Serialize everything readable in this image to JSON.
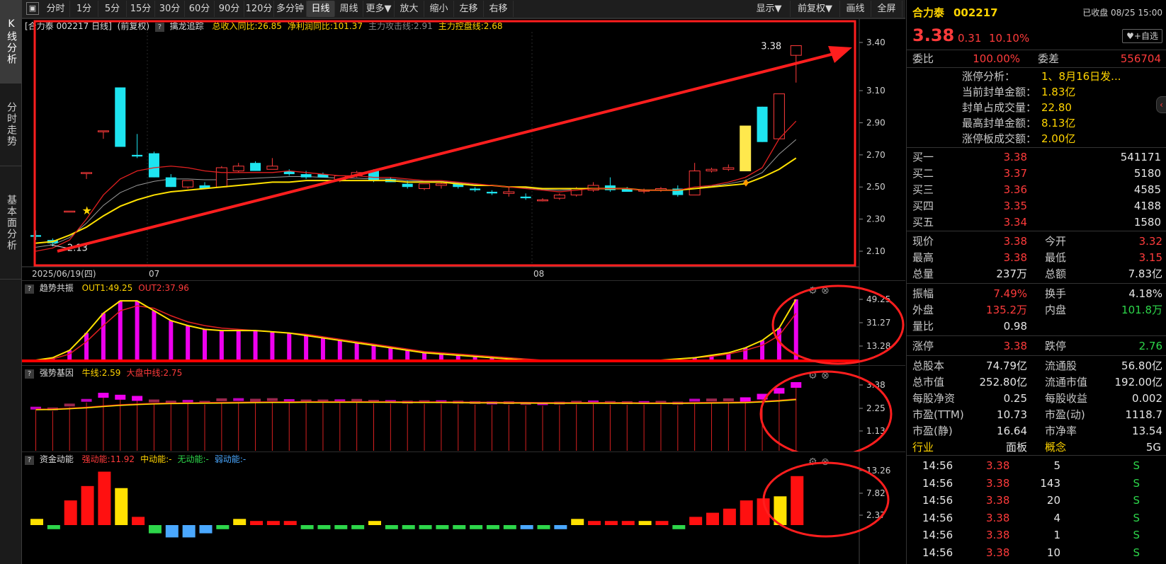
{
  "vtabs": [
    "K线分析",
    "分时走势",
    "基本面分析"
  ],
  "toolbar": {
    "periods": [
      "分时",
      "1分",
      "5分",
      "15分",
      "30分",
      "60分",
      "90分",
      "120分",
      "多分钟",
      "日线",
      "周线",
      "更多▼",
      "放大",
      "缩小",
      "左移",
      "右移"
    ],
    "active_period": "日线",
    "right": [
      "显示▼",
      "前复权▼",
      "画线",
      "全屏"
    ]
  },
  "main_chart": {
    "title_stock": "[合力泰 002217 日线]",
    "title_adjust": "(前复权)",
    "indicator_name": "擒龙追踪",
    "ind_items": [
      {
        "text": "总收入同比:26.85",
        "color": "#ffd400"
      },
      {
        "text": "净利润同比:101.37",
        "color": "#ffd400"
      },
      {
        "text": "主力攻击线:2.91",
        "color": "#888888"
      },
      {
        "text": "主力控盘线:2.68",
        "color": "#ffd400"
      }
    ],
    "y_ticks": [
      "3.40",
      "3.10",
      "2.90",
      "2.70",
      "2.50",
      "2.30",
      "2.10"
    ],
    "x_labels": [
      "2025/06/19(四)",
      "07",
      "08"
    ],
    "high_label": "3.38",
    "low_label": "2.13",
    "colors": {
      "up": "#ff3b3b",
      "down": "#1ee4f0",
      "ma_yellow": "#ffe100",
      "ma_red": "#e02020",
      "ma_gray": "#9a9a9a",
      "annotation": "#ff1e1e"
    }
  },
  "trend_panel": {
    "name": "趋势共振",
    "items": [
      {
        "text": "OUT1:49.25",
        "color": "#ffd400"
      },
      {
        "text": "OUT2:37.96",
        "color": "#ff3b3b"
      }
    ],
    "y_ticks": [
      "49.25",
      "31.27",
      "13.28"
    ]
  },
  "gene_panel": {
    "name": "强势基因",
    "items": [
      {
        "text": "牛线:2.59",
        "color": "#ffd400"
      },
      {
        "text": "大盘中线:2.75",
        "color": "#ff3b3b"
      }
    ],
    "y_ticks": [
      "3.38",
      "2.25",
      "1.13"
    ]
  },
  "fund_panel": {
    "name": "资金动能",
    "items": [
      {
        "text": "强动能:11.92",
        "color": "#ff3b3b"
      },
      {
        "text": "中动能:-",
        "color": "#ffd400"
      },
      {
        "text": "无动能:-",
        "color": "#2dd64a"
      },
      {
        "text": "弱动能:-",
        "color": "#4aa8ff"
      }
    ],
    "y_ticks": [
      "13.26",
      "7.82",
      "2.37"
    ]
  },
  "chart_data": {
    "type": "candlestick",
    "series": [
      {
        "name": "price",
        "ohlc": [
          [
            2.2,
            2.23,
            2.17,
            2.19
          ],
          [
            2.17,
            2.18,
            2.13,
            2.15
          ],
          [
            2.35,
            2.35,
            2.35,
            2.35
          ],
          [
            2.59,
            2.59,
            2.55,
            2.59
          ],
          [
            2.85,
            2.85,
            2.8,
            2.85
          ],
          [
            3.12,
            3.12,
            2.75,
            2.75
          ],
          [
            2.7,
            2.83,
            2.68,
            2.69
          ],
          [
            2.71,
            2.72,
            2.56,
            2.56
          ],
          [
            2.56,
            2.58,
            2.5,
            2.5
          ],
          [
            2.5,
            2.54,
            2.49,
            2.54
          ],
          [
            2.51,
            2.53,
            2.49,
            2.49
          ],
          [
            2.5,
            2.63,
            2.5,
            2.62
          ],
          [
            2.6,
            2.65,
            2.59,
            2.63
          ],
          [
            2.65,
            2.66,
            2.6,
            2.6
          ],
          [
            2.61,
            2.68,
            2.61,
            2.63
          ],
          [
            2.6,
            2.61,
            2.57,
            2.58
          ],
          [
            2.58,
            2.6,
            2.55,
            2.56
          ],
          [
            2.58,
            2.59,
            2.56,
            2.56
          ],
          [
            2.54,
            2.57,
            2.53,
            2.57
          ],
          [
            2.57,
            2.6,
            2.56,
            2.59
          ],
          [
            2.6,
            2.61,
            2.53,
            2.54
          ],
          [
            2.55,
            2.56,
            2.53,
            2.53
          ],
          [
            2.52,
            2.54,
            2.49,
            2.5
          ],
          [
            2.49,
            2.52,
            2.48,
            2.52
          ],
          [
            2.51,
            2.53,
            2.49,
            2.52
          ],
          [
            2.52,
            2.53,
            2.49,
            2.5
          ],
          [
            2.49,
            2.5,
            2.47,
            2.48
          ],
          [
            2.47,
            2.48,
            2.45,
            2.46
          ],
          [
            2.46,
            2.5,
            2.44,
            2.47
          ],
          [
            2.44,
            2.46,
            2.42,
            2.43
          ],
          [
            2.42,
            2.43,
            2.41,
            2.42
          ],
          [
            2.43,
            2.46,
            2.42,
            2.45
          ],
          [
            2.45,
            2.5,
            2.44,
            2.49
          ],
          [
            2.48,
            2.53,
            2.47,
            2.51
          ],
          [
            2.51,
            2.56,
            2.47,
            2.48
          ],
          [
            2.49,
            2.5,
            2.47,
            2.47
          ],
          [
            2.48,
            2.49,
            2.46,
            2.48
          ],
          [
            2.48,
            2.5,
            2.47,
            2.49
          ],
          [
            2.49,
            2.51,
            2.44,
            2.45
          ],
          [
            2.45,
            2.65,
            2.45,
            2.6
          ],
          [
            2.6,
            2.62,
            2.59,
            2.61
          ],
          [
            2.61,
            2.64,
            2.6,
            2.62
          ],
          [
            2.88,
            2.88,
            2.6,
            2.6
          ],
          [
            3.0,
            3.0,
            2.78,
            2.78
          ],
          [
            2.8,
            3.08,
            2.8,
            3.08
          ],
          [
            3.32,
            3.38,
            3.15,
            3.38
          ]
        ]
      },
      {
        "name": "主力控盘线",
        "values": [
          2.15,
          2.16,
          2.2,
          2.25,
          2.32,
          2.38,
          2.42,
          2.45,
          2.47,
          2.48,
          2.49,
          2.5,
          2.51,
          2.52,
          2.53,
          2.53,
          2.54,
          2.54,
          2.54,
          2.54,
          2.54,
          2.54,
          2.53,
          2.53,
          2.53,
          2.52,
          2.51,
          2.51,
          2.5,
          2.5,
          2.49,
          2.49,
          2.49,
          2.49,
          2.49,
          2.49,
          2.48,
          2.48,
          2.48,
          2.49,
          2.5,
          2.51,
          2.52,
          2.56,
          2.61,
          2.68
        ]
      },
      {
        "name": "主力攻击线",
        "values": [
          2.1,
          2.12,
          2.17,
          2.3,
          2.45,
          2.55,
          2.6,
          2.62,
          2.63,
          2.62,
          2.6,
          2.59,
          2.59,
          2.59,
          2.59,
          2.6,
          2.59,
          2.58,
          2.57,
          2.57,
          2.56,
          2.56,
          2.55,
          2.54,
          2.54,
          2.53,
          2.52,
          2.51,
          2.5,
          2.49,
          2.48,
          2.47,
          2.48,
          2.49,
          2.49,
          2.49,
          2.48,
          2.48,
          2.48,
          2.5,
          2.51,
          2.53,
          2.56,
          2.62,
          2.8,
          2.91
        ]
      },
      {
        "name": "OUT1",
        "values": [
          0,
          2,
          8,
          22,
          38,
          48,
          48,
          40,
          32,
          28,
          25,
          24,
          24,
          24,
          23,
          22,
          20,
          18,
          16,
          14,
          12,
          10,
          8,
          6,
          5,
          4,
          3,
          2,
          1,
          0,
          0,
          0,
          0,
          0,
          0,
          0,
          0,
          0,
          1,
          2,
          4,
          6,
          10,
          16,
          26,
          49.25
        ]
      },
      {
        "name": "OUT2",
        "values": [
          0,
          1,
          5,
          15,
          28,
          40,
          44,
          42,
          36,
          31,
          28,
          26,
          25,
          24,
          23,
          22,
          21,
          19,
          17,
          15,
          13,
          11,
          9,
          7,
          6,
          5,
          4,
          3,
          2,
          1,
          0,
          0,
          0,
          0,
          0,
          0,
          0,
          0,
          1,
          2,
          3,
          5,
          8,
          12,
          20,
          37.96
        ]
      },
      {
        "name": "强动能",
        "values": [
          1.5,
          -1,
          6,
          9.5,
          13,
          9,
          2,
          -2,
          -3,
          -3,
          -2,
          -1,
          1.5,
          1,
          1,
          1,
          -1,
          -1,
          -1,
          -1,
          1,
          -1,
          -1,
          -1,
          -1,
          -1,
          -1,
          -1,
          -1,
          -1,
          -1,
          -1,
          1.5,
          1,
          1,
          1,
          1,
          1,
          -1,
          2,
          3,
          4,
          6,
          6.5,
          7,
          11.92
        ]
      }
    ],
    "gene": {
      "bull_line": 2.59,
      "market_mid": 2.75
    }
  },
  "right_panel": {
    "stock_name": "合力泰",
    "stock_code": "002217",
    "status": "已收盘 08/25 15:00",
    "price": "3.38",
    "change": "0.31",
    "pct": "10.10%",
    "add_watch": "♥+自选",
    "weibi_label": "委比",
    "weibi": "100.00%",
    "weicha_label": "委差",
    "weicha": "556704",
    "limit_analysis": [
      {
        "label": "涨停分析：",
        "value": "1、8月16日发..."
      },
      {
        "label": "当前封单金额：",
        "value": "1.83亿"
      },
      {
        "label": "封单占成交量：",
        "value": "22.80"
      },
      {
        "label": "最高封单金额：",
        "value": "8.13亿"
      },
      {
        "label": "涨停板成交额：",
        "value": "2.00亿"
      }
    ],
    "bids": [
      {
        "label": "买一",
        "price": "3.38",
        "vol": "541171"
      },
      {
        "label": "买二",
        "price": "3.37",
        "vol": "5180"
      },
      {
        "label": "买三",
        "price": "3.36",
        "vol": "4585"
      },
      {
        "label": "买四",
        "price": "3.35",
        "vol": "4188"
      },
      {
        "label": "买五",
        "price": "3.34",
        "vol": "1580"
      }
    ],
    "quote_rows": [
      [
        {
          "l": "现价",
          "v": "3.38",
          "c": "red"
        },
        {
          "l": "今开",
          "v": "3.32",
          "c": "red"
        }
      ],
      [
        {
          "l": "最高",
          "v": "3.38",
          "c": "red"
        },
        {
          "l": "最低",
          "v": "3.15",
          "c": "red"
        }
      ],
      [
        {
          "l": "总量",
          "v": "237万",
          "c": "val"
        },
        {
          "l": "总额",
          "v": "7.83亿",
          "c": "val"
        }
      ]
    ],
    "stat_rows": [
      [
        {
          "l": "振幅",
          "v": "7.49%",
          "c": "red"
        },
        {
          "l": "换手",
          "v": "4.18%",
          "c": "val"
        }
      ],
      [
        {
          "l": "外盘",
          "v": "135.2万",
          "c": "red"
        },
        {
          "l": "内盘",
          "v": "101.8万",
          "c": "green"
        }
      ],
      [
        {
          "l": "量比",
          "v": "0.98",
          "c": "val"
        },
        {
          "l": "",
          "v": "",
          "c": "val"
        }
      ]
    ],
    "limit_rows": [
      [
        {
          "l": "涨停",
          "v": "3.38",
          "c": "red"
        },
        {
          "l": "跌停",
          "v": "2.76",
          "c": "green"
        }
      ]
    ],
    "fund_rows": [
      [
        {
          "l": "总股本",
          "v": "74.79亿",
          "c": "val"
        },
        {
          "l": "流通股",
          "v": "56.80亿",
          "c": "val"
        }
      ],
      [
        {
          "l": "总市值",
          "v": "252.80亿",
          "c": "val"
        },
        {
          "l": "流通市值",
          "v": "192.00亿",
          "c": "val"
        }
      ],
      [
        {
          "l": "每股净资",
          "v": "0.25",
          "c": "val"
        },
        {
          "l": "每股收益",
          "v": "0.002",
          "c": "val"
        }
      ],
      [
        {
          "l": "市盈(TTM)",
          "v": "10.73",
          "c": "val"
        },
        {
          "l": "市盈(动)",
          "v": "1118.7",
          "c": "val"
        }
      ],
      [
        {
          "l": "市盈(静)",
          "v": "16.64",
          "c": "val"
        },
        {
          "l": "市净率",
          "v": "13.54",
          "c": "val"
        }
      ]
    ],
    "industry_label": "行业",
    "industry": "面板",
    "concept_label": "概念",
    "concept": "5G",
    "ticks": [
      {
        "time": "14:56",
        "price": "3.38",
        "vol": "5",
        "side": "S"
      },
      {
        "time": "14:56",
        "price": "3.38",
        "vol": "143",
        "side": "S"
      },
      {
        "time": "14:56",
        "price": "3.38",
        "vol": "20",
        "side": "S"
      },
      {
        "time": "14:56",
        "price": "3.38",
        "vol": "4",
        "side": "S"
      },
      {
        "time": "14:56",
        "price": "3.38",
        "vol": "1",
        "side": "S"
      },
      {
        "time": "14:56",
        "price": "3.38",
        "vol": "10",
        "side": "S"
      }
    ]
  }
}
